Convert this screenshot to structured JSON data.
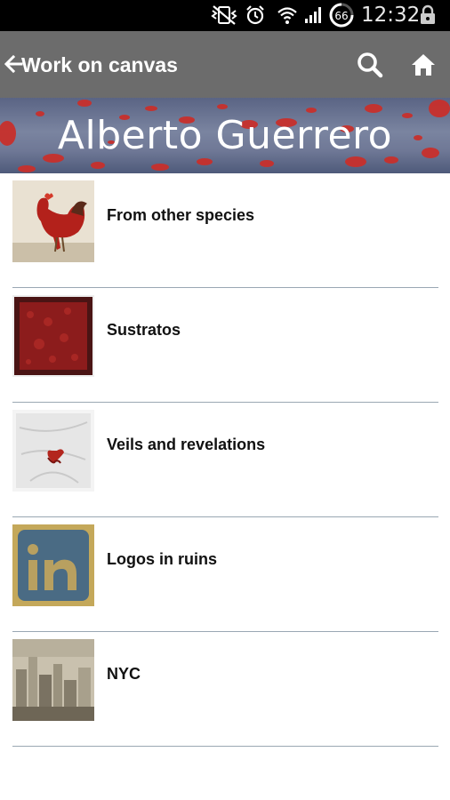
{
  "status_bar": {
    "time": "12:32",
    "battery": "66",
    "icons": [
      "vibrate-mute-icon",
      "alarm-icon",
      "wifi-icon",
      "signal-icon",
      "battery-icon",
      "lock-icon"
    ]
  },
  "app_bar": {
    "title": "Work on canvas",
    "icons": [
      "back-arrow-icon",
      "search-icon",
      "home-icon"
    ],
    "background": "#6c6c6c"
  },
  "banner": {
    "artist_name": "Alberto Guerrero"
  },
  "collections": [
    {
      "label": "From other species",
      "thumb": "rooster"
    },
    {
      "label": "Sustratos",
      "thumb": "red-texture"
    },
    {
      "label": "Veils and revelations",
      "thumb": "white-veil"
    },
    {
      "label": "Logos in ruins",
      "thumb": "linkedin-logo"
    },
    {
      "label": "NYC",
      "thumb": "city-skyline"
    }
  ]
}
